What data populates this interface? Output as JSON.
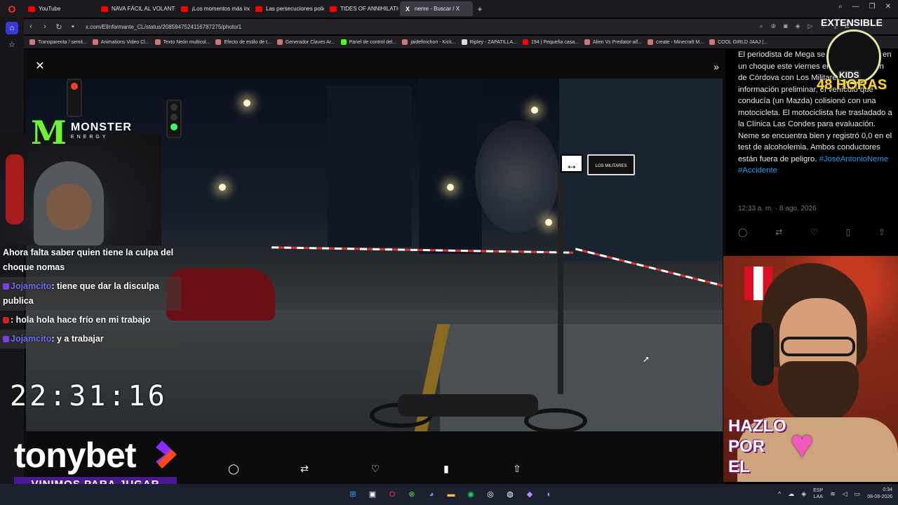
{
  "tabs": [
    {
      "title": "YouTube",
      "icon": "youtube-icon",
      "active": false
    },
    {
      "title": "NAVA FÁCIL AL VOLANTE",
      "icon": "youtube-icon",
      "active": false
    },
    {
      "title": "¡Los momentos más incre",
      "icon": "youtube-icon",
      "active": false
    },
    {
      "title": "Las persecuciones policial",
      "icon": "youtube-icon",
      "active": false
    },
    {
      "title": "TIDES OF ANNIHILATION",
      "icon": "youtube-icon",
      "active": false
    },
    {
      "title": "neme - Buscar / X",
      "icon": "x-icon",
      "active": true
    }
  ],
  "address": {
    "url": "x.com/ElInformante_CL/status/2085947524116787275/photo/1"
  },
  "bookmarks": [
    "Transparenta / semit...",
    "Animations Video Cl...",
    "Texto Neón multicol...",
    "Efecto de estilo de t...",
    "Generador Claves Ar...",
    "Panel de control del...",
    "jaidefinichon - Kick...",
    "Ripley - ZAPATILLA...",
    "194 | Pequeña casa...",
    "Alien Vs Predator-alf...",
    "create - Minecraft M...",
    "COOL GIRLD JAAJ |..."
  ],
  "photo": {
    "street_sign": "LOS MILITARES"
  },
  "tweet": {
    "text": "El periodista de Mega se vio involucrado en un choque este viernes en la intersección de Córdova con Los Militares. Según información preliminar, el vehículo que conducía (un Mazda) colisionó con una motocicleta. El motociclista fue trasladado a la Clínica Las Condes para evaluación. Neme se encuentra bien y registró 0,0 en el test de alcoholemia. Ambos conductores están fuera de peligro.",
    "hashtags": "#JoséAntonioNeme #Accidente",
    "timestamp": "12:33 a. m. · 8 ago. 2026"
  },
  "overlay": {
    "monster_word": "MONSTER",
    "monster_sub": "ENERGY",
    "chat": [
      {
        "user": "",
        "text": "Ahora falta saber quien tiene la culpa del choque nomas",
        "user_class": "gray"
      },
      {
        "user": "Jojamcito",
        "text": ": tiene que dar la disculpa publica",
        "user_class": ""
      },
      {
        "user": "",
        "text": ": hola hola hace frío en mi trabajo",
        "user_class": "red"
      },
      {
        "user": "Jojamcito",
        "text": ": y a trabajar",
        "user_class": ""
      }
    ],
    "clock": "22:31:16",
    "brand": "tonybet",
    "slogan": "VINIMOS PARA JUGAR",
    "hazlo": [
      "HAZLO",
      "POR",
      "EL"
    ],
    "extensible_title": "EXTENSIBLE",
    "extensible_kids": "KIDS",
    "extensible_hours": "48 HORAS"
  },
  "taskbar": {
    "lang_top": "ESP",
    "lang_bottom": "LAA",
    "time": "0:34",
    "date": "08-08-2026"
  }
}
